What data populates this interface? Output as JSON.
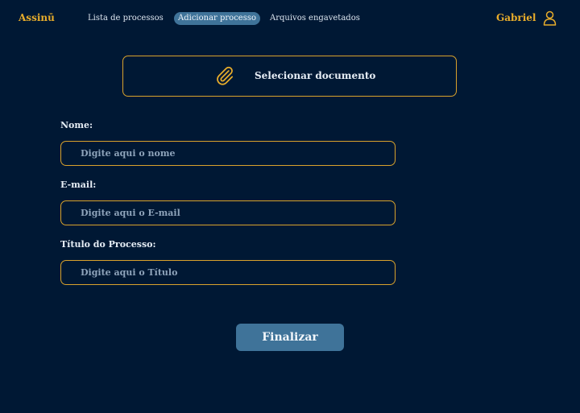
{
  "app": {
    "brand": "Assinū",
    "user_name": "Gabriel"
  },
  "nav": {
    "items": [
      {
        "label": "Lista de processos",
        "active": false
      },
      {
        "label": "Adicionar processo",
        "active": true
      },
      {
        "label": "Arquivos engavetados",
        "active": false
      }
    ]
  },
  "document": {
    "select_label": "Selecionar documento",
    "icon": "paperclip-icon"
  },
  "form": {
    "fields": [
      {
        "label": "Nome:",
        "placeholder": "Digite aqui o nome"
      },
      {
        "label": "E-mail:",
        "placeholder": "Digite aqui o E-mail"
      },
      {
        "label": "Título do Processo:",
        "placeholder": "Digite aqui o Título"
      }
    ],
    "submit_label": "Finalizar"
  },
  "colors": {
    "background": "#001834",
    "accent": "#e8ad2b",
    "button": "#3f7399"
  }
}
